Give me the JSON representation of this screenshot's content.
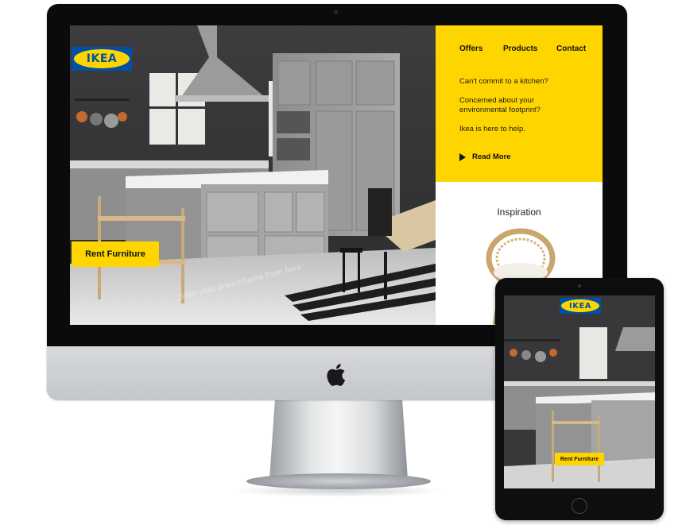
{
  "brand": {
    "logo_text": "IKEA",
    "yellow": "#ffd500",
    "blue": "#0051a2"
  },
  "desktop": {
    "nav": {
      "items": [
        "Offers",
        "Products",
        "Contact"
      ]
    },
    "hero": {
      "rent_button": "Rent Furniture",
      "tagline": "Start your dream home from here"
    },
    "side_panel": {
      "line1": "Can't commit to a kitchen?",
      "line2": "Concerned about your environmental footprint?",
      "line3": "Ikea is here to help.",
      "read_more": "Read More",
      "inspiration_title": "Inspiration"
    }
  },
  "tablet": {
    "logo_text": "IKEA",
    "rent_button": "Rent Furniture"
  },
  "device_labels": {
    "imac_logo": "apple-logo"
  }
}
